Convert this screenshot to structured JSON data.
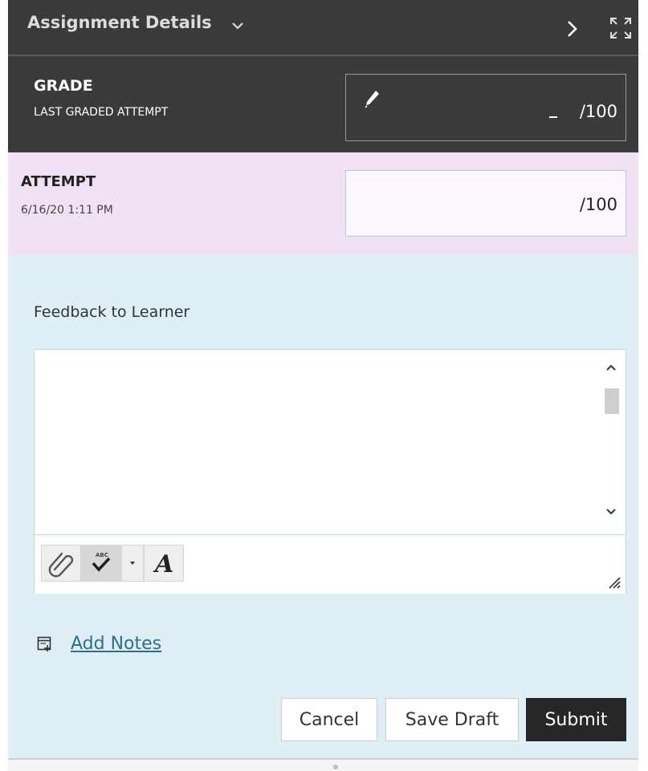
{
  "header": {
    "title": "Assignment Details",
    "icons": [
      "chevron-down-icon",
      "chevron-right-icon",
      "expand-icon"
    ]
  },
  "grade": {
    "label": "GRADE",
    "sublabel": "LAST GRADED ATTEMPT",
    "value": "-",
    "out_of": "/100"
  },
  "attempt": {
    "label": "ATTEMPT",
    "date": "6/16/20 1:11 PM",
    "out_of": "/100"
  },
  "feedback": {
    "label": "Feedback to Learner",
    "value": "",
    "toolbar_icons": [
      "paperclip-icon",
      "spellcheck-icon",
      "dropdown-arrow-icon",
      "font-icon"
    ]
  },
  "notes": {
    "link_label": "Add Notes"
  },
  "actions": {
    "cancel_label": "Cancel",
    "save_draft_label": "Save Draft",
    "submit_label": "Submit"
  },
  "colors": {
    "header_bg": "#3a3a3a",
    "attempt_bg": "#f1e1f4",
    "feedback_bg": "#dfeff5",
    "link": "#2b6d8f",
    "submit_bg": "#262626"
  }
}
